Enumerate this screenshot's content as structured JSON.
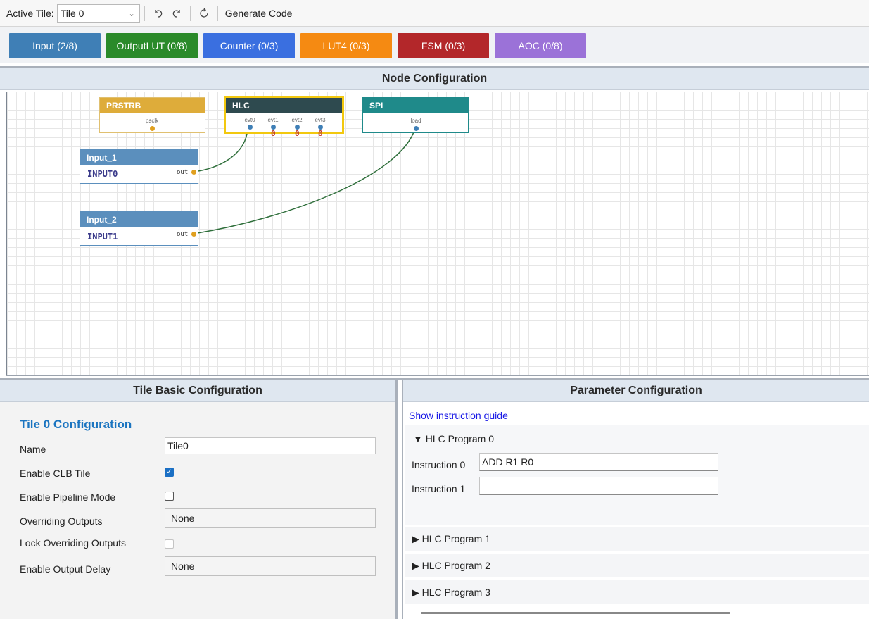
{
  "toolbar": {
    "active_tile_label": "Active Tile:",
    "active_tile_value": "Tile 0",
    "undo_icon": "undo-icon",
    "redo_icon": "redo-icon",
    "refresh_icon": "refresh-icon",
    "generate_code_label": "Generate Code"
  },
  "palette": [
    {
      "label": "Input (2/8)",
      "color": "#3f7fb6"
    },
    {
      "label": "OutputLUT (0/8)",
      "color": "#2a8a2a"
    },
    {
      "label": "Counter (0/3)",
      "color": "#3a6fe0"
    },
    {
      "label": "LUT4 (0/3)",
      "color": "#f58a12"
    },
    {
      "label": "FSM (0/3)",
      "color": "#b3272a"
    },
    {
      "label": "AOC (0/8)",
      "color": "#9b72d8"
    }
  ],
  "node_config": {
    "title": "Node Configuration",
    "nodes": {
      "prstrb": {
        "title": "PRSTRB",
        "port": "psclk",
        "color": "#deac3a"
      },
      "hlc": {
        "title": "HLC",
        "ports": [
          "evt0",
          "evt1",
          "evt2",
          "evt3"
        ],
        "values": [
          "",
          "0",
          "0",
          "0"
        ],
        "color": "#2e4a4f",
        "border_color": "#f2c80f"
      },
      "spi": {
        "title": "SPI",
        "port": "load",
        "color": "#1f8a8a"
      },
      "input1": {
        "title": "Input_1",
        "value": "INPUT0",
        "out": "out",
        "color": "#5b8fbd"
      },
      "input2": {
        "title": "Input_2",
        "value": "INPUT1",
        "out": "out",
        "color": "#5b8fbd"
      }
    }
  },
  "tile_basic": {
    "title": "Tile Basic Configuration",
    "heading": "Tile 0 Configuration",
    "name_label": "Name",
    "name_value": "Tile0",
    "enable_clb_label": "Enable CLB Tile",
    "enable_clb_checked": "✓",
    "pipeline_label": "Enable Pipeline Mode",
    "overriding_label": "Overriding Outputs",
    "overriding_value": "None",
    "lock_label": "Lock Overriding Outputs",
    "output_delay_label": "Enable Output Delay",
    "output_delay_value": "None"
  },
  "parameter": {
    "title": "Parameter Configuration",
    "guide_link": "Show instruction guide",
    "program0": "▼ HLC Program 0",
    "instr0_label": "Instruction 0",
    "instr0_value": "ADD R1 R0",
    "instr1_label": "Instruction 1",
    "instr1_value": "",
    "program1": "▶ HLC Program 1",
    "program2": "▶ HLC Program 2",
    "program3": "▶ HLC Program 3"
  }
}
